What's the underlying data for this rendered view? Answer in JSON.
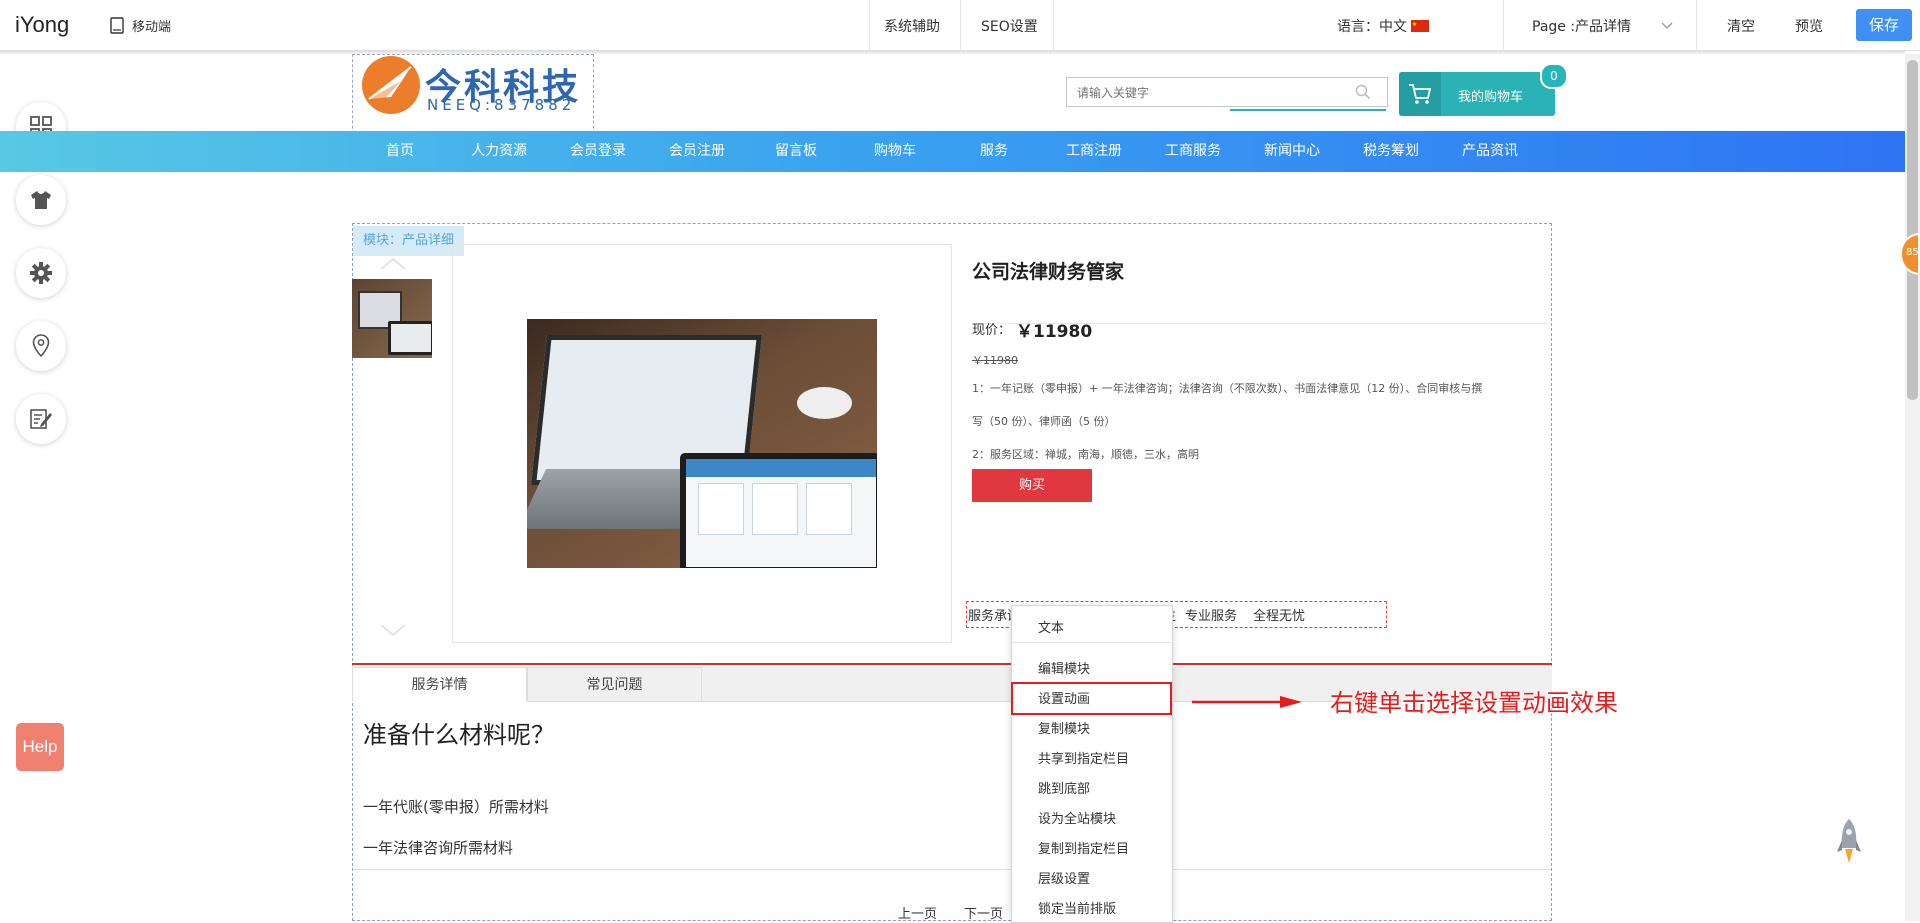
{
  "toolbar": {
    "app_name": "iYong",
    "mobile_label": "移动端",
    "system_assist": "系统辅助",
    "seo_settings": "SEO设置",
    "language_label": "语言：中文",
    "page_label": "Page :产品详情",
    "clear_label": "清空",
    "preview_label": "预览",
    "save_label": "保存"
  },
  "site": {
    "logo_name": "今科科技",
    "logo_sub": "NEEQ:837882",
    "search_placeholder": "请输入关键字",
    "cart_label": "我的购物车",
    "cart_count": "0",
    "nav": [
      "首页",
      "人力资源",
      "会员登录",
      "会员注册",
      "留言板",
      "购物车",
      "服务",
      "工商注册",
      "工商服务",
      "新闻中心",
      "税务筹划",
      "产品资讯"
    ]
  },
  "module": {
    "label": "模块：产品详细"
  },
  "product": {
    "title": "公司法律财务管家",
    "price_label": "现价：",
    "price": "￥11980",
    "old_price": "￥11980",
    "desc1": "1：一年记账（零申报）+ 一年法律咨询；法律咨询（不限次数）、书面法律意见（12 份）、合同审核与撰",
    "desc2": "写（50 份）、律师函（5 份）",
    "desc3": "2：服务区域：禅城，南海，顺德，三水，高明",
    "buy_label": "购买",
    "promise_prefix": "服务承诺",
    "promise_fragment": "生",
    "promise_professional": "专业服务",
    "promise_worry": "全程无忧"
  },
  "tabs": [
    "服务详情",
    "常见问题"
  ],
  "detail": {
    "heading": "准备什么材料呢？",
    "line1": "一年代账(零申报）所需材料",
    "line2": "一年法律咨询所需材料",
    "prev": "上一页",
    "next": "下一页"
  },
  "context_menu": {
    "items": [
      "文本",
      "编辑模块",
      "设置动画",
      "复制模块",
      "共享到指定栏目",
      "跳到底部",
      "设为全站模块",
      "复制到指定栏目",
      "层级设置",
      "锁定当前排版"
    ]
  },
  "annotation": "右键单击选择设置动画效果",
  "help_label": "Help",
  "right_badge": "85",
  "colors": {
    "accent": "#3f8ff4",
    "nav_start": "#58c8e4",
    "nav_end": "#2e74f4",
    "cart": "#2ab2b4",
    "buy": "#e0383f",
    "annotation": "#e41c1c"
  }
}
